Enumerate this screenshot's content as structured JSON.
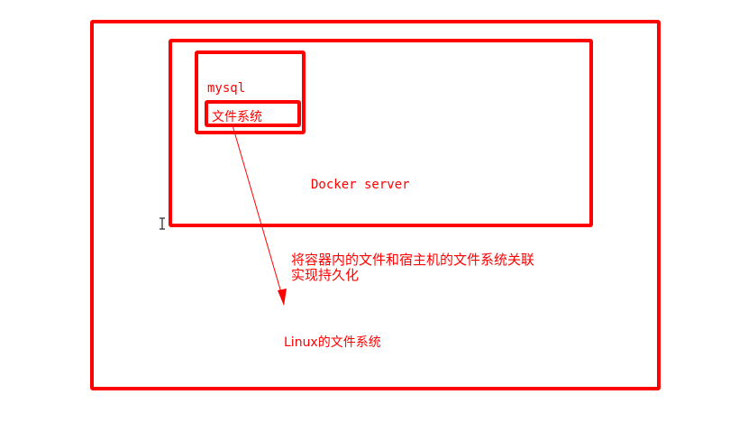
{
  "colors": {
    "accent": "#ff0000"
  },
  "labels": {
    "mysql": "mysql",
    "container_fs": "文件系统",
    "docker_server": "Docker server",
    "note_line1": "将容器内的文件和宿主机的文件系统关联",
    "note_line2": "实现持久化",
    "host_fs": "Linux的文件系统"
  },
  "icons": {
    "cursor": "text-cursor-icon"
  }
}
